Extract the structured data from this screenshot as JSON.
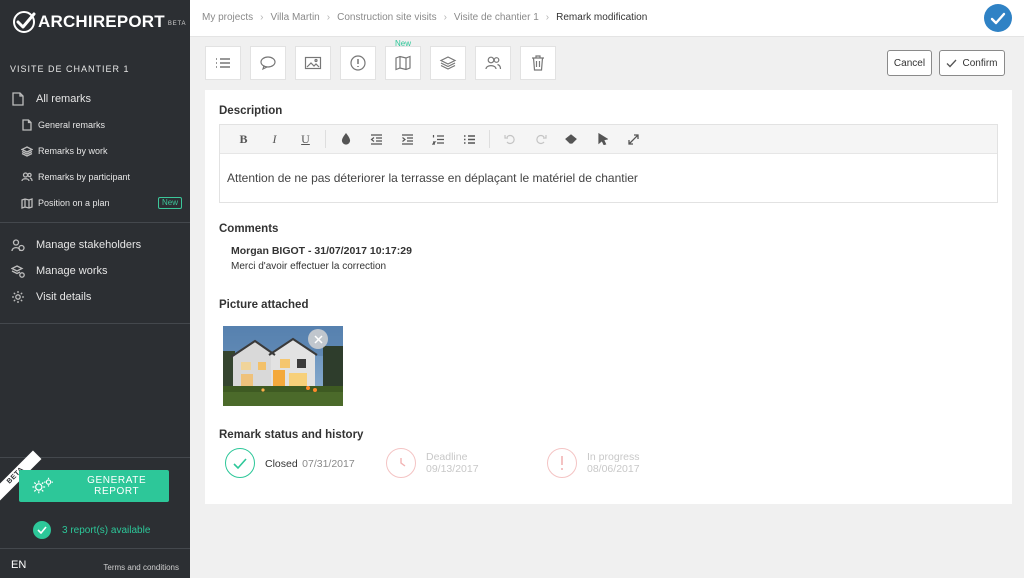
{
  "sidebar": {
    "logo_text": "ARCHIREPORT",
    "logo_badge": "BETA",
    "visit_title": "VISITE DE CHANTIER 1",
    "main_items": [
      {
        "label": "All remarks",
        "icon": "document-icon"
      }
    ],
    "sub_items": [
      {
        "label": "General remarks",
        "icon": "document-icon"
      },
      {
        "label": "Remarks by work",
        "icon": "layers-icon"
      },
      {
        "label": "Remarks by participant",
        "icon": "users-icon"
      },
      {
        "label": "Position on a plan",
        "icon": "map-icon",
        "badge": "New"
      }
    ],
    "manage_items": [
      {
        "label": "Manage stakeholders",
        "icon": "stakeholders-icon"
      },
      {
        "label": "Manage works",
        "icon": "works-icon"
      },
      {
        "label": "Visit details",
        "icon": "gear-icon"
      }
    ],
    "beta_ribbon": "BETA",
    "generate_button": "GENERATE REPORT",
    "reports_available": "3 report(s) available",
    "language": "EN",
    "terms": "Terms and conditions"
  },
  "header": {
    "breadcrumb": [
      "My projects",
      "Villa Martin",
      "Construction site visits",
      "Visite de chantier 1",
      "Remark modification"
    ]
  },
  "toolbar": {
    "tools": [
      {
        "name": "list",
        "icon": "list-icon"
      },
      {
        "name": "comment",
        "icon": "comment-icon"
      },
      {
        "name": "image",
        "icon": "image-icon"
      },
      {
        "name": "alert",
        "icon": "alert-icon"
      },
      {
        "name": "plan",
        "icon": "map-icon",
        "badge": "New"
      },
      {
        "name": "layers",
        "icon": "layers-icon"
      },
      {
        "name": "participants",
        "icon": "users-icon"
      },
      {
        "name": "delete",
        "icon": "trash-icon"
      }
    ],
    "cancel_label": "Cancel",
    "confirm_label": "Confirm"
  },
  "description": {
    "title": "Description",
    "text": "Attention de ne pas déteriorer la terrasse en déplaçant le matériel de chantier"
  },
  "comments": {
    "title": "Comments",
    "items": [
      {
        "author_line": "Morgan BIGOT - 31/07/2017 10:17:29",
        "text": "Merci d'avoir effectuer la correction"
      }
    ]
  },
  "picture": {
    "title": "Picture attached"
  },
  "status_history": {
    "title": "Remark status and history",
    "items": [
      {
        "label": "Closed",
        "date": "07/31/2017",
        "icon": "check-circle-icon"
      },
      {
        "label": "Deadline",
        "date": "09/13/2017",
        "icon": "clock-icon"
      },
      {
        "label": "In progress",
        "date": "08/06/2017",
        "icon": "exclamation-icon"
      }
    ]
  },
  "colors": {
    "sidebar_bg": "#2c2f33",
    "accent_green": "#2dc799",
    "accent_blue": "#2f82c5",
    "status_red": "#f2b8b8"
  }
}
